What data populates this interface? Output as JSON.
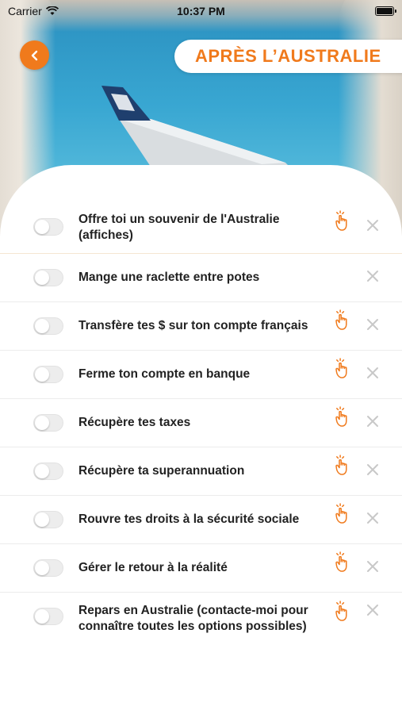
{
  "status_bar": {
    "carrier": "Carrier",
    "time": "10:37 PM"
  },
  "header": {
    "title": "APRÈS L’AUSTRALIE"
  },
  "colors": {
    "accent": "#f07a1c",
    "text": "#222222",
    "close_icon": "#c8c8c8"
  },
  "tasks": [
    {
      "label": "Offre toi un souvenir de l'Australie (affiches)",
      "checked": false,
      "has_hand_icon": true
    },
    {
      "label": "Mange une raclette entre potes",
      "checked": false,
      "has_hand_icon": false
    },
    {
      "label": "Transfère tes $ sur ton compte français",
      "checked": false,
      "has_hand_icon": true
    },
    {
      "label": "Ferme ton compte en banque",
      "checked": false,
      "has_hand_icon": true
    },
    {
      "label": "Récupère tes taxes",
      "checked": false,
      "has_hand_icon": true
    },
    {
      "label": "Récupère ta superannuation",
      "checked": false,
      "has_hand_icon": true
    },
    {
      "label": "Rouvre tes droits à la sécurité sociale",
      "checked": false,
      "has_hand_icon": true
    },
    {
      "label": "Gérer le retour à la réalité",
      "checked": false,
      "has_hand_icon": true
    },
    {
      "label": "Repars en Australie (contacte-moi pour connaître toutes les options possibles)",
      "checked": false,
      "has_hand_icon": true
    }
  ]
}
